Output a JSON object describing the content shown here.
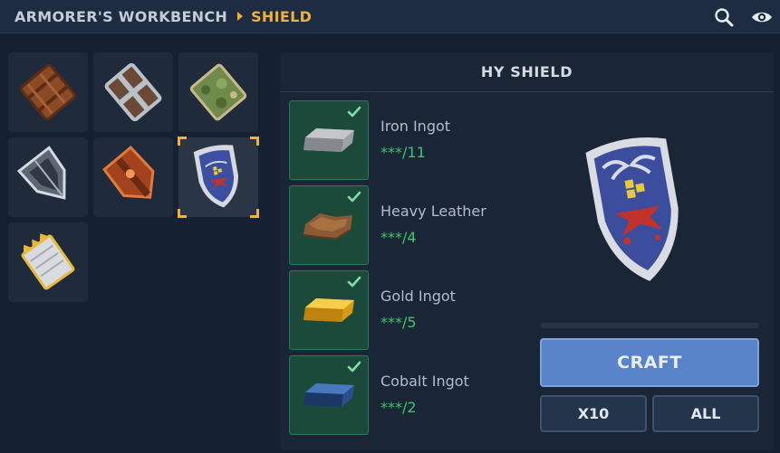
{
  "breadcrumb": {
    "root": "ARMORER'S WORKBENCH",
    "current": "SHIELD"
  },
  "header_icons": [
    "search-icon",
    "eye-icon"
  ],
  "items": [
    {
      "name": "wooden-shield",
      "selected": false
    },
    {
      "name": "iron-banded-shield",
      "selected": false
    },
    {
      "name": "leafy-shield",
      "selected": false
    },
    {
      "name": "silver-kite-shield",
      "selected": false
    },
    {
      "name": "copper-ornate-shield",
      "selected": false
    },
    {
      "name": "hy-shield",
      "selected": true
    },
    {
      "name": "golden-tower-shield",
      "selected": false
    }
  ],
  "recipe": {
    "title": "HY SHIELD",
    "ingredients": [
      {
        "name": "Iron Ingot",
        "count": "***/11"
      },
      {
        "name": "Heavy Leather",
        "count": "***/4"
      },
      {
        "name": "Gold Ingot",
        "count": "***/5"
      },
      {
        "name": "Cobalt Ingot",
        "count": "***/2"
      }
    ],
    "progress": 0,
    "craft_label": "CRAFT",
    "x10_label": "X10",
    "all_label": "ALL"
  },
  "colors": {
    "accent": "#f0b03a",
    "ingredient_ok": "#3ec46d",
    "craft_button": "#5a84c9"
  }
}
